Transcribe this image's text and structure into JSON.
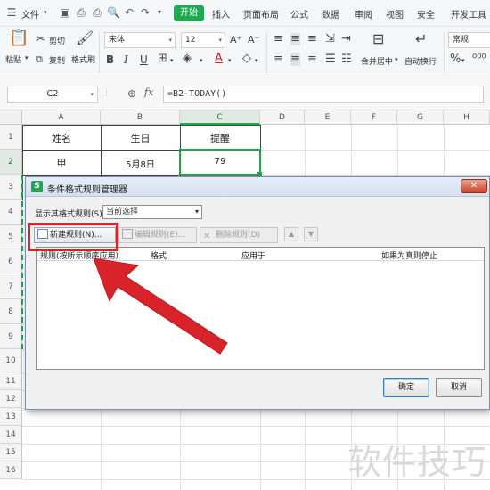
{
  "menubar": {
    "file": "文件",
    "tabs": [
      {
        "label": "开始",
        "active": true
      },
      {
        "label": "插入"
      },
      {
        "label": "页面布局"
      },
      {
        "label": "公式"
      },
      {
        "label": "数据"
      },
      {
        "label": "审阅"
      },
      {
        "label": "视图"
      },
      {
        "label": "安全"
      },
      {
        "label": "开发工具"
      }
    ]
  },
  "ribbon": {
    "paste": "粘贴",
    "cut": "剪切",
    "copy": "复制",
    "format_painter": "格式刷",
    "font_name": "宋体",
    "font_size": "12",
    "merge_center": "合并居中",
    "wrap_text": "自动换行",
    "number_format": "常规",
    "bold": "B",
    "italic": "I",
    "underline": "U",
    "font_color_glyph": "A"
  },
  "formula_bar": {
    "name_box": "C2",
    "fx": "fx",
    "formula": "=B2-TODAY()"
  },
  "sheet": {
    "columns": [
      "A",
      "B",
      "C",
      "D",
      "E",
      "F",
      "G",
      "H"
    ],
    "rows": [
      "1",
      "2",
      "3",
      "4",
      "5",
      "6",
      "7",
      "8",
      "9",
      "10",
      "11",
      "12",
      "13",
      "14",
      "15",
      "16"
    ],
    "headers": {
      "a1": "姓名",
      "b1": "生日",
      "c1": "提醒"
    },
    "row2": {
      "a2": "甲",
      "b2": "5月8日",
      "c2": "79"
    },
    "selected_cell": "C2"
  },
  "dialog": {
    "title": "条件格式规则管理器",
    "close_glyph": "✕",
    "show_rules_label": "显示其格式规则(S):",
    "show_rules_value": "当前选择",
    "new_rule": "新建规则(N)...",
    "edit_rule": "编辑规则(E)...",
    "delete_rule": "删除规则(D)",
    "move_up": "▲",
    "move_down": "▼",
    "columns": {
      "rule": "规则(按所示顺序应用)",
      "format": "格式",
      "applies_to": "应用于",
      "stop_if_true": "如果为真则停止"
    },
    "ok": "确定",
    "cancel": "取消"
  },
  "watermark": "软件技巧",
  "colors": {
    "accent_green": "#1fa84f",
    "highlight_red": "#d8232a"
  }
}
